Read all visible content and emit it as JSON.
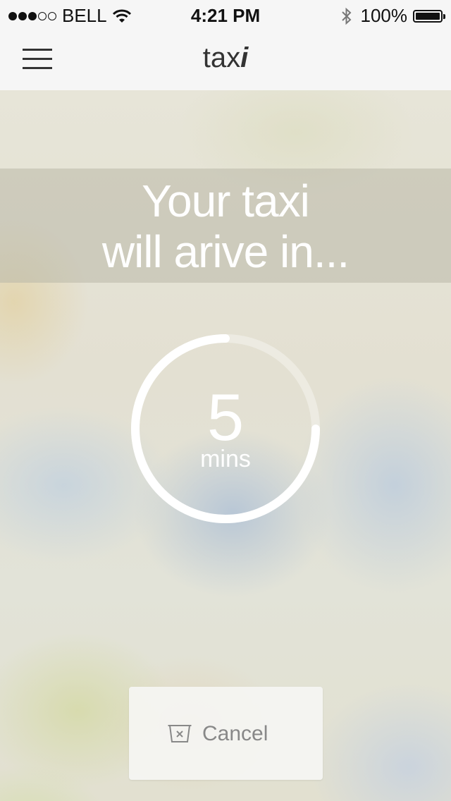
{
  "status_bar": {
    "carrier": "BELL",
    "time": "4:21 PM",
    "battery": "100%",
    "signal_bars": 3,
    "signal_total": 5
  },
  "nav": {
    "logo_light": "tax",
    "logo_bold": "i"
  },
  "banner": {
    "line1": "Your taxi",
    "line2": "will arive in..."
  },
  "timer": {
    "value": "5",
    "unit": "mins",
    "progress": 0.75
  },
  "cancel": {
    "label": "Cancel"
  },
  "colors": {
    "bars": "#f6f6f6",
    "text_dark": "#333333",
    "ring": "#ffffff"
  }
}
